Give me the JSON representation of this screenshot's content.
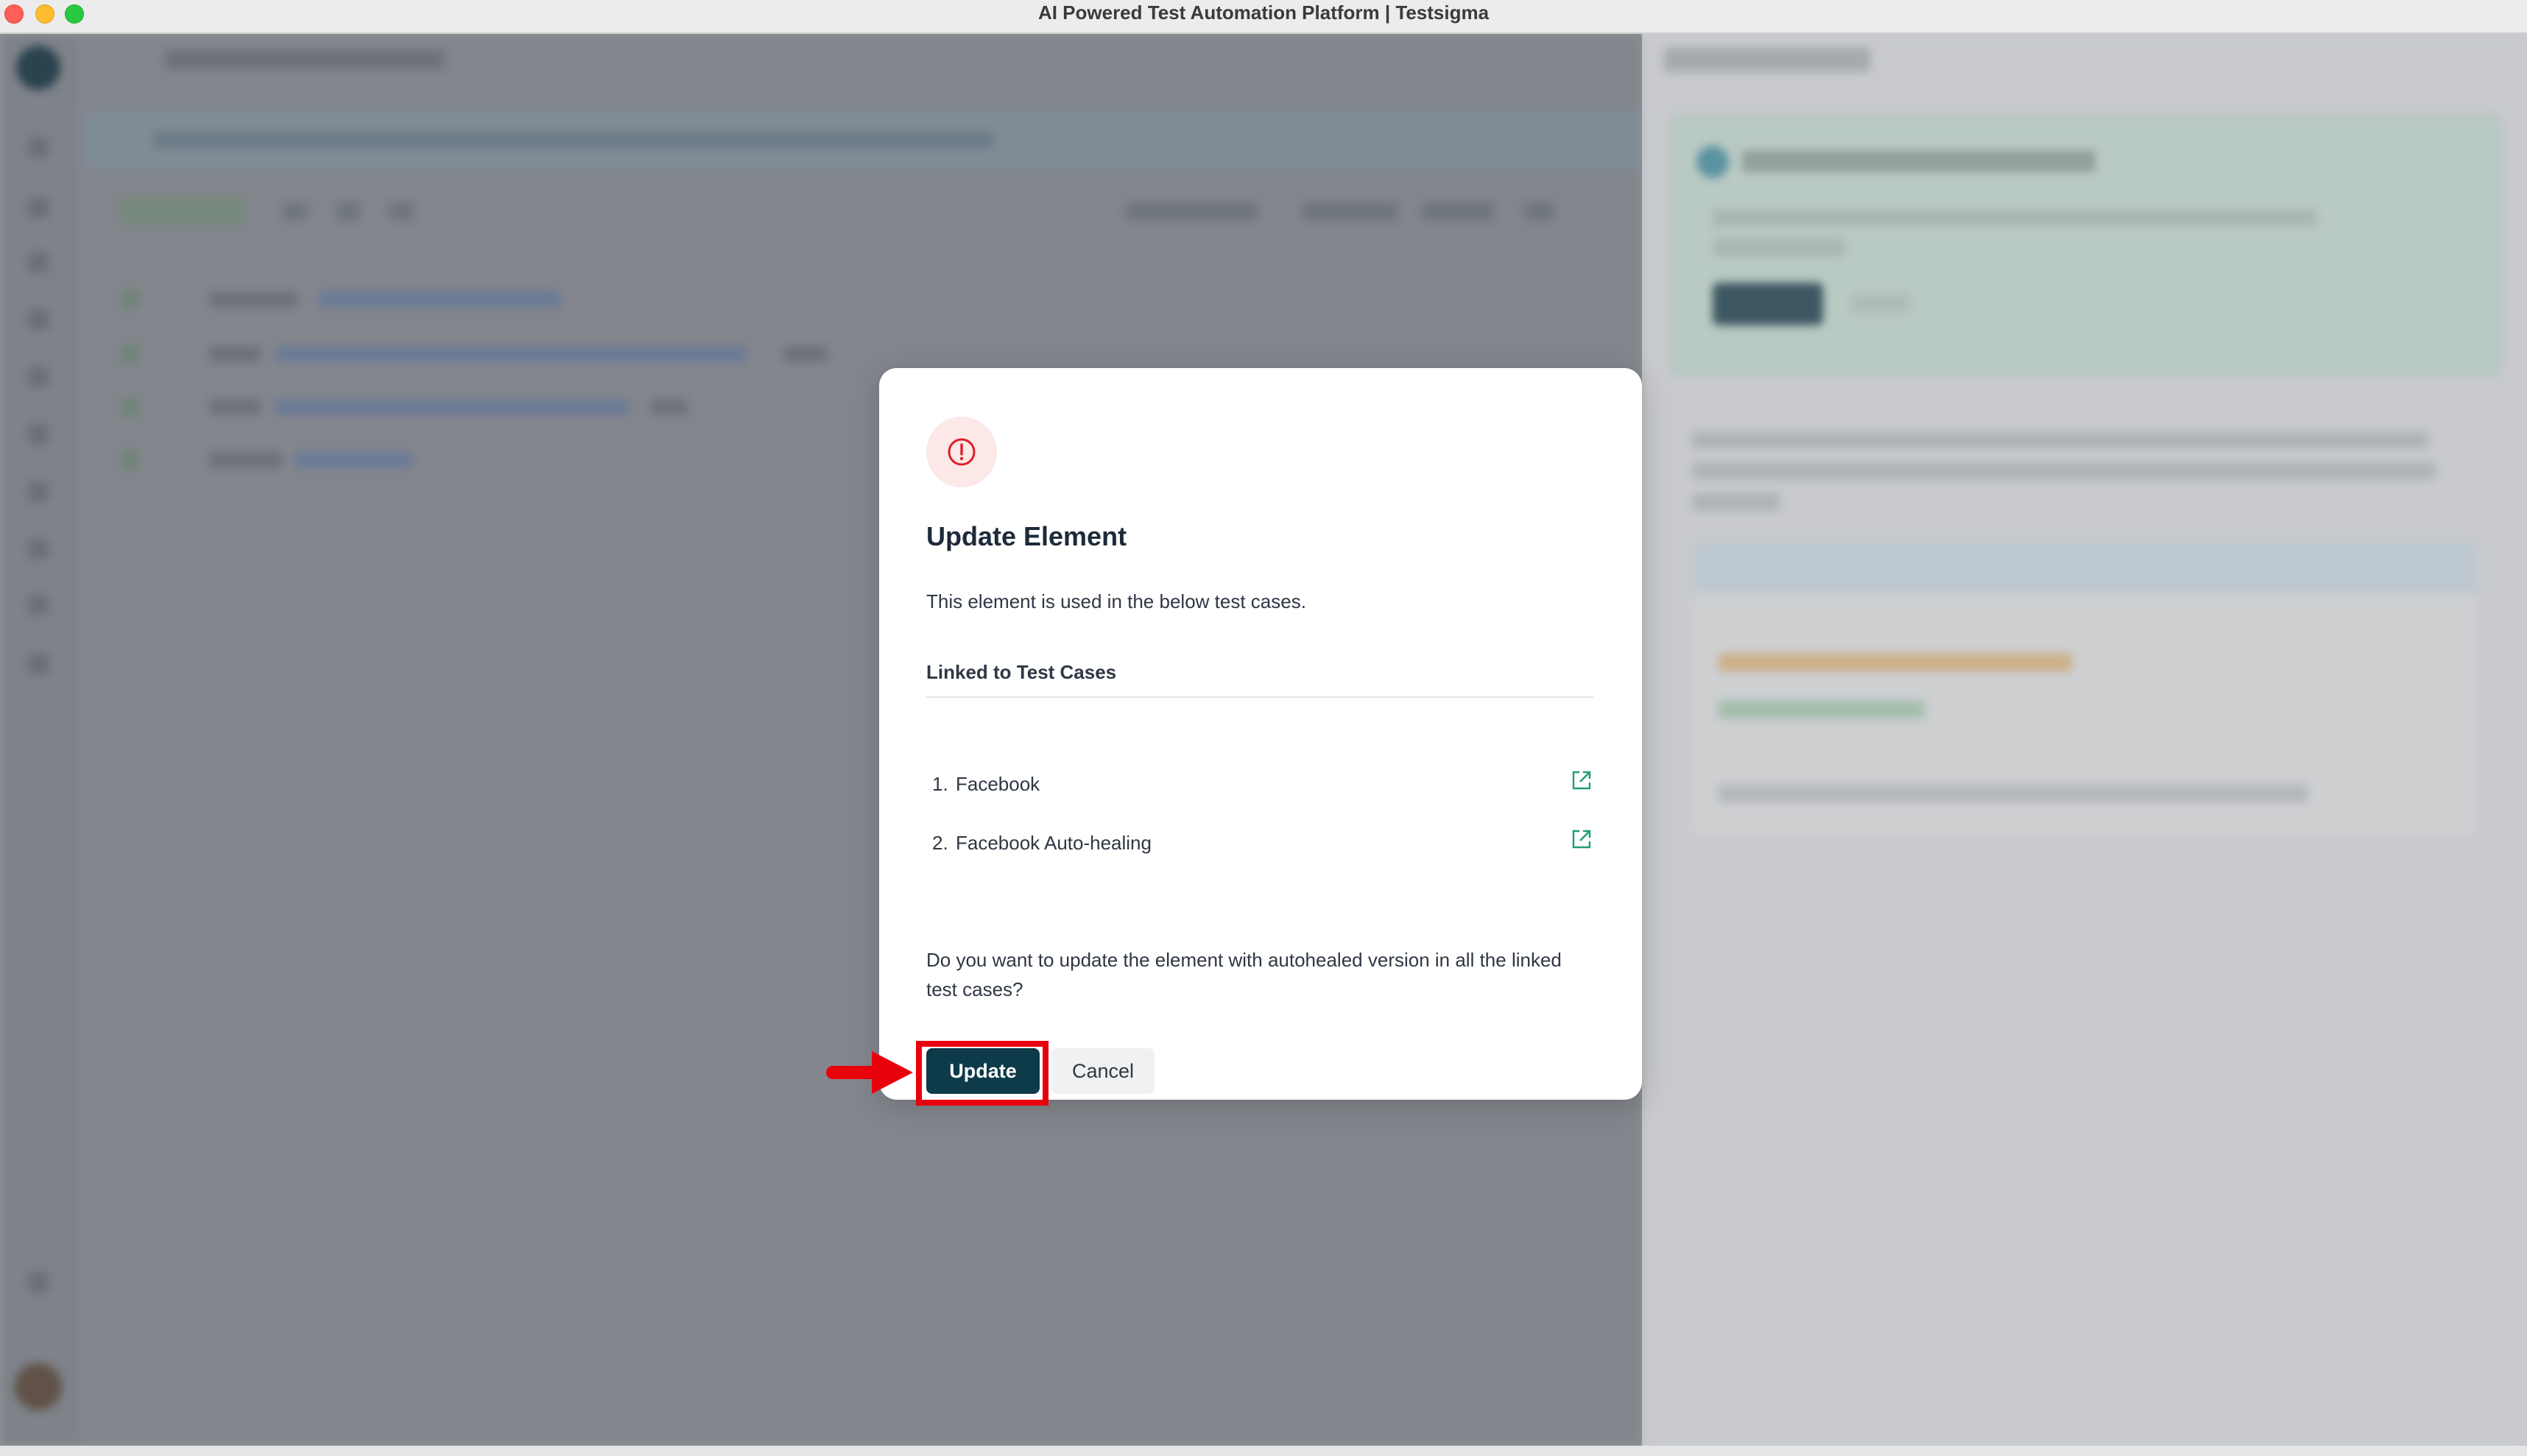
{
  "window": {
    "title": "AI Powered Test Automation Platform | Testsigma"
  },
  "modal": {
    "title": "Update Element",
    "subtitle": "This element is used in the below test cases.",
    "linked_heading": "Linked to Test Cases",
    "items": [
      {
        "number": "1.",
        "label": "Facebook",
        "icon": "external-link-icon"
      },
      {
        "number": "2.",
        "label": "Facebook Auto-healing",
        "icon": "external-link-icon"
      }
    ],
    "question": "Do you want to update the element with autohealed version in all the linked test cases?",
    "update_label": "Update",
    "cancel_label": "Cancel",
    "icon": "alert-circle-icon"
  },
  "colors": {
    "primary_button": "#0d3b4a",
    "alert_red": "#e11d2a",
    "link_green": "#1f9d7a",
    "annotation_red": "#e8000d"
  }
}
